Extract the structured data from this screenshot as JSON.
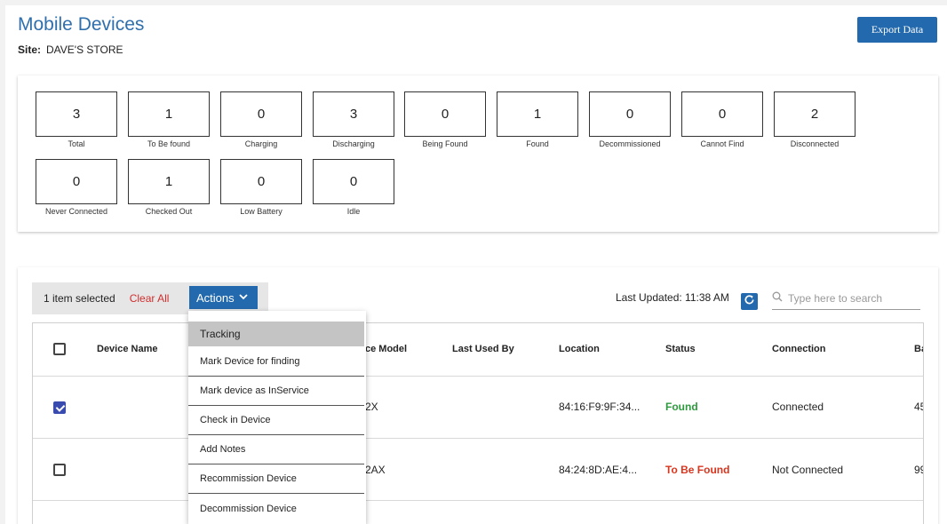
{
  "header": {
    "title": "Mobile Devices",
    "site_label": "Site:",
    "site_value": "DAVE'S STORE",
    "export_label": "Export Data"
  },
  "stats": [
    {
      "value": "3",
      "label": "Total"
    },
    {
      "value": "1",
      "label": "To Be found"
    },
    {
      "value": "0",
      "label": "Charging"
    },
    {
      "value": "3",
      "label": "Discharging"
    },
    {
      "value": "0",
      "label": "Being Found"
    },
    {
      "value": "1",
      "label": "Found"
    },
    {
      "value": "0",
      "label": "Decommissioned"
    },
    {
      "value": "0",
      "label": "Cannot Find"
    },
    {
      "value": "2",
      "label": "Disconnected"
    },
    {
      "value": "0",
      "label": "Never Connected"
    },
    {
      "value": "1",
      "label": "Checked Out"
    },
    {
      "value": "0",
      "label": "Low Battery"
    },
    {
      "value": "0",
      "label": "Idle"
    }
  ],
  "toolbar": {
    "selected_text": "1 item selected",
    "clear_all": "Clear All",
    "actions_label": "Actions",
    "last_updated": "Last Updated: 11:38 AM",
    "search_placeholder": "Type here to search"
  },
  "table": {
    "columns": [
      "Device Name",
      "ce Model",
      "Last Used By",
      "Location",
      "Status",
      "Connection",
      "Ba"
    ],
    "rows": [
      {
        "checked": true,
        "model": "2X",
        "location": "84:16:F9:9F:34...",
        "status": "Found",
        "connection": "Connected",
        "battery": "45"
      },
      {
        "checked": false,
        "model": "2AX",
        "location": "84:24:8D:AE:4...",
        "status": "To Be Found",
        "connection": "Not Connected",
        "battery": "99"
      }
    ]
  },
  "actions_menu": [
    "Tracking",
    "Mark Device for finding",
    "Mark device as InService",
    "Check in Device",
    "Add Notes",
    "Recommission Device",
    "Decommission Device"
  ],
  "colors": {
    "accent": "#2369ad",
    "title": "#2f6fad",
    "found": "#2e9a3e",
    "to_be_found": "#d8361f",
    "clear_all": "#d12e2e"
  }
}
